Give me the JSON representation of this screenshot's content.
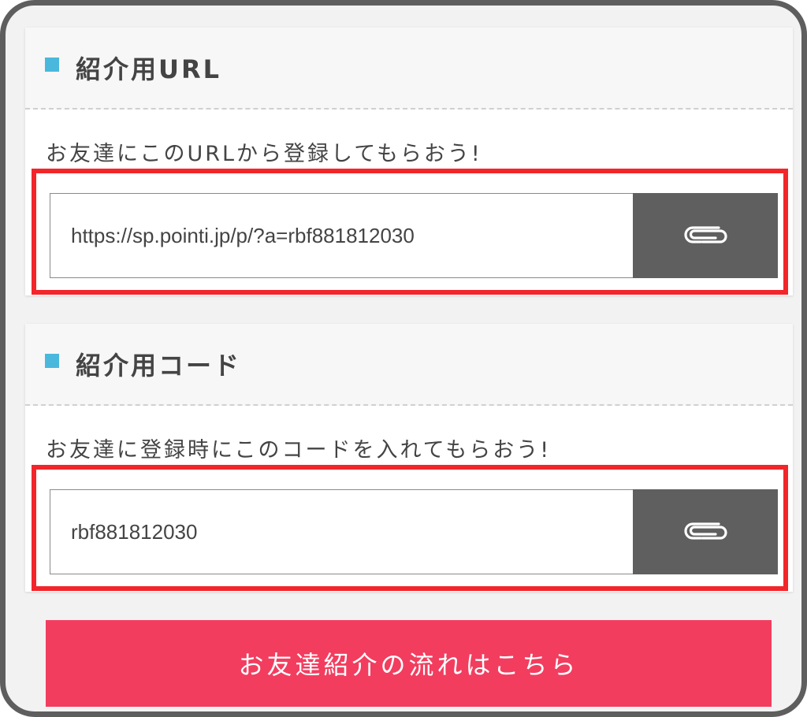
{
  "colors": {
    "accent_square": "#4ab8dc",
    "highlight_border": "#f2262a",
    "copy_button": "#5f5f5f",
    "cta_background": "#f23d5f"
  },
  "url_section": {
    "title": "紹介用URL",
    "description": "お友達にこのURLから登録してもらおう!",
    "value": "https://sp.pointi.jp/p/?a=rbf881812030",
    "copy_icon": "paperclip-icon"
  },
  "code_section": {
    "title": "紹介用コード",
    "description": "お友達に登録時にこのコードを入れてもらおう!",
    "value": "rbf881812030",
    "copy_icon": "paperclip-icon"
  },
  "cta": {
    "label": "お友達紹介の流れはこちら"
  }
}
